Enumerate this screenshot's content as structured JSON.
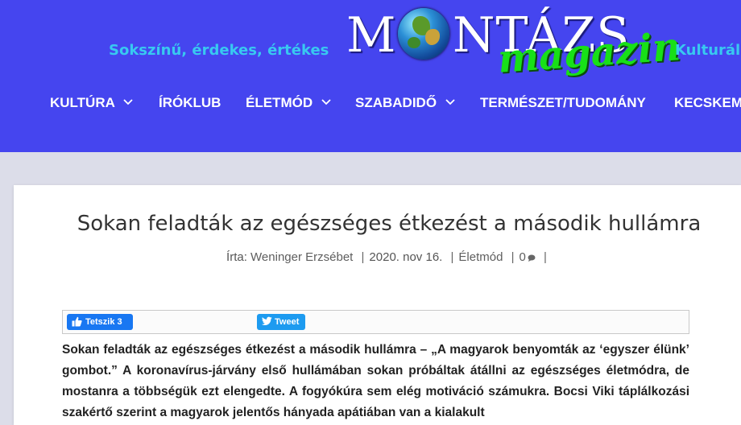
{
  "header": {
    "tagline_left": "Sokszínű, érdekes, értékes",
    "tagline_right": "Kulturális",
    "logo": {
      "word_m": "M",
      "word_rest": "NTÁZS",
      "sub": "magazin"
    },
    "colors": {
      "background": "#4545ef",
      "tagline": "#38c9f0",
      "logo_sub": "#18e018"
    }
  },
  "nav": {
    "items": [
      {
        "label": "KULTÚRA",
        "has_dropdown": true
      },
      {
        "label": "ÍRÓKLUB",
        "has_dropdown": false
      },
      {
        "label": "ÉLETMÓD",
        "has_dropdown": true
      },
      {
        "label": "SZABADIDŐ",
        "has_dropdown": true
      },
      {
        "label": "TERMÉSZET/TUDOMÁNY",
        "has_dropdown": false
      },
      {
        "label": "KECSKEM",
        "has_dropdown": false
      }
    ],
    "chevron_icon": "chevron-down-icon"
  },
  "article": {
    "title": "Sokan feladták az egészséges étkezést a második hullámra",
    "meta": {
      "author_prefix": "Írta:",
      "author": "Weninger Erzsébet",
      "date": "2020. nov 16.",
      "category": "Életmód",
      "comments": "0",
      "separator": "|"
    },
    "share": {
      "facebook_label": "Tetszik 3",
      "facebook_icon": "thumbs-up-icon",
      "twitter_label": "Tweet",
      "twitter_icon": "twitter-bird-icon"
    },
    "body": "Sokan feladták az egészséges étkezést a második hullámra – „A magyarok benyomták az ‘egyszer élünk’ gombot.” A koronavírus-járvány első hullámában sokan próbáltak átállni az egészséges életmódra, de mostanra a többségük ezt elengedte. A fogyókúra sem elég motiváció számukra. Bocsi Viki táplálkozási szakértő szerint a magyarok jelentős hányada apátiában van a kialakult"
  }
}
